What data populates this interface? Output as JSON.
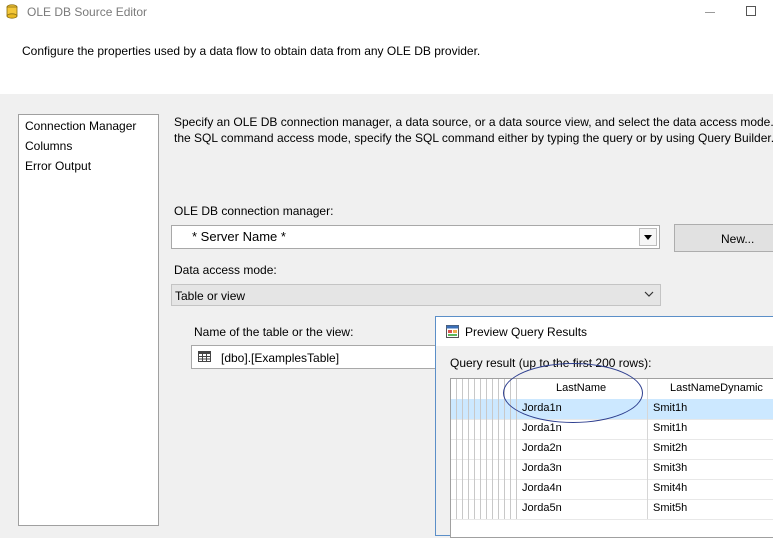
{
  "window": {
    "title": "OLE DB Source Editor",
    "description": "Configure the properties used by a data flow to obtain data from any OLE DB provider."
  },
  "nav": {
    "items": [
      {
        "label": "Connection Manager"
      },
      {
        "label": "Columns"
      },
      {
        "label": "Error Output"
      }
    ]
  },
  "instructions": {
    "line1": "Specify an OLE DB connection manager, a data source, or a data source view, and select the data access mode. If u",
    "line2": "the SQL command access mode, specify the SQL command either by typing the query or by using Query Builder. To"
  },
  "connection": {
    "label": "OLE DB connection manager:",
    "value": "* Server Name *",
    "new_button": "New..."
  },
  "access_mode": {
    "label": "Data access mode:",
    "value": "Table or view"
  },
  "table": {
    "label": "Name of the table or the view:",
    "value": "[dbo].[ExamplesTable]"
  },
  "preview": {
    "title": "Preview Query Results",
    "sublabel": "Query result (up to the first 200 rows):",
    "columns": [
      "LastName",
      "LastNameDynamic"
    ],
    "rows": [
      [
        "Jorda1n",
        "Smit1h"
      ],
      [
        "Jorda1n",
        "Smit1h"
      ],
      [
        "Jorda2n",
        "Smit2h"
      ],
      [
        "Jorda3n",
        "Smit3h"
      ],
      [
        "Jorda4n",
        "Smit4h"
      ],
      [
        "Jorda5n",
        "Smit5h"
      ]
    ],
    "selected_row": 0
  },
  "colors": {
    "accent": "#5b8fc8",
    "selection": "#cce8ff",
    "annotation": "#2e3f8f"
  },
  "icons": {
    "app": "ssis-source-icon",
    "table": "table-grid-icon",
    "preview": "preview-window-icon",
    "dropdown": "chevron-down-icon"
  }
}
